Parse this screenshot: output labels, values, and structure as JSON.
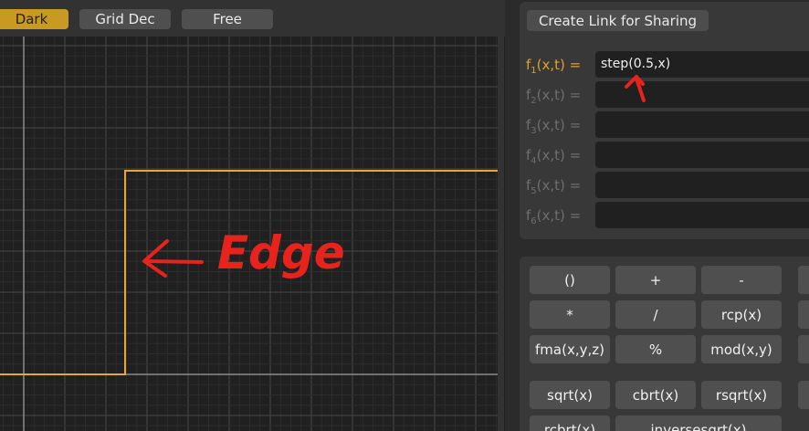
{
  "top_bar": {
    "buttons": [
      {
        "label": "Dark",
        "active": true
      },
      {
        "label": "Grid Dec",
        "active": false
      },
      {
        "label": "Free",
        "active": false
      }
    ]
  },
  "plot": {
    "function": "step(0.5,x)",
    "annotation_text": "Edge",
    "annotation_arrow": "left-arrow",
    "curve_color": "#e8a63a",
    "annotation_color": "#e8231e"
  },
  "functions": {
    "share_label": "Create Link for Sharing",
    "rows": [
      {
        "label": "f",
        "sub": "1",
        "suffix": "(x,t) =",
        "value": "step(0.5,x)",
        "active": true
      },
      {
        "label": "f",
        "sub": "2",
        "suffix": "(x,t) =",
        "value": "",
        "active": false
      },
      {
        "label": "f",
        "sub": "3",
        "suffix": "(x,t) =",
        "value": "",
        "active": false
      },
      {
        "label": "f",
        "sub": "4",
        "suffix": "(x,t) =",
        "value": "",
        "active": false
      },
      {
        "label": "f",
        "sub": "5",
        "suffix": "(x,t) =",
        "value": "",
        "active": false
      },
      {
        "label": "f",
        "sub": "6",
        "suffix": "(x,t) =",
        "value": "",
        "active": false
      }
    ]
  },
  "keypad": {
    "keys": [
      "()",
      "+",
      "-",
      "*",
      "/",
      "rcp(x)",
      "fma(x,y,z)",
      "%",
      "mod(x,y)",
      "sqrt(x)",
      "cbrt(x)",
      "rsqrt(x)",
      "rcbrt(x)",
      "inversesqrt(x)"
    ]
  }
}
